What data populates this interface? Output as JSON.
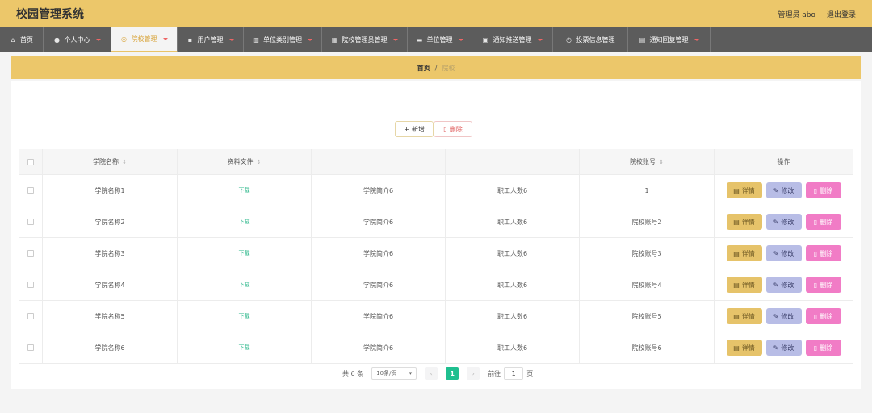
{
  "app": {
    "title": "校园管理系统",
    "user_label": "管理员 abo",
    "logout_label": "退出登录"
  },
  "nav": [
    {
      "label": "首页",
      "icon": "home-icon",
      "active": false
    },
    {
      "label": "个人中心",
      "icon": "user-icon",
      "active": false
    },
    {
      "label": "院校管理",
      "icon": "compass-icon",
      "active": true
    },
    {
      "label": "用户管理",
      "icon": "chat-icon",
      "active": false
    },
    {
      "label": "单位类别管理",
      "icon": "chart-icon",
      "active": false
    },
    {
      "label": "院校管理员管理",
      "icon": "building-icon",
      "active": false
    },
    {
      "label": "单位管理",
      "icon": "monitor-icon",
      "active": false
    },
    {
      "label": "通知推送管理",
      "icon": "image-icon",
      "active": false
    },
    {
      "label": "投票信息管理",
      "icon": "clock-icon",
      "active": false
    },
    {
      "label": "通知回复管理",
      "icon": "doc-icon",
      "active": false
    }
  ],
  "breadcrumb": {
    "home": "首页",
    "separator": "/",
    "current": "院校"
  },
  "toolbar": {
    "add_label": "新增",
    "delete_label": "删除"
  },
  "table": {
    "headers": [
      "学院名称",
      "资料文件",
      "",
      "",
      "院校账号",
      "操作"
    ],
    "rows": [
      {
        "name": "学院名称1",
        "file": "下载",
        "intro": "学院简介6",
        "staff": "职工人数6",
        "account": "1"
      },
      {
        "name": "学院名称2",
        "file": "下载",
        "intro": "学院简介6",
        "staff": "职工人数6",
        "account": "院校账号2"
      },
      {
        "name": "学院名称3",
        "file": "下载",
        "intro": "学院简介6",
        "staff": "职工人数6",
        "account": "院校账号3"
      },
      {
        "name": "学院名称4",
        "file": "下载",
        "intro": "学院简介6",
        "staff": "职工人数6",
        "account": "院校账号4"
      },
      {
        "name": "学院名称5",
        "file": "下载",
        "intro": "学院简介6",
        "staff": "职工人数6",
        "account": "院校账号5"
      },
      {
        "name": "学院名称6",
        "file": "下载",
        "intro": "学院简介6",
        "staff": "职工人数6",
        "account": "院校账号6"
      }
    ],
    "ops": {
      "detail": "详情",
      "edit": "修改",
      "delete": "删除"
    }
  },
  "pagination": {
    "total": "共 6 条",
    "page_size": "10条/页",
    "current_page": "1",
    "goto_label": "前往",
    "goto_value": "1",
    "page_suffix": "页"
  },
  "colors": {
    "accent": "#ecc76a",
    "nav": "#5c5c5c",
    "primary": "#1fbf8f",
    "delete": "#f17cc6",
    "edit": "#b8bde6"
  }
}
